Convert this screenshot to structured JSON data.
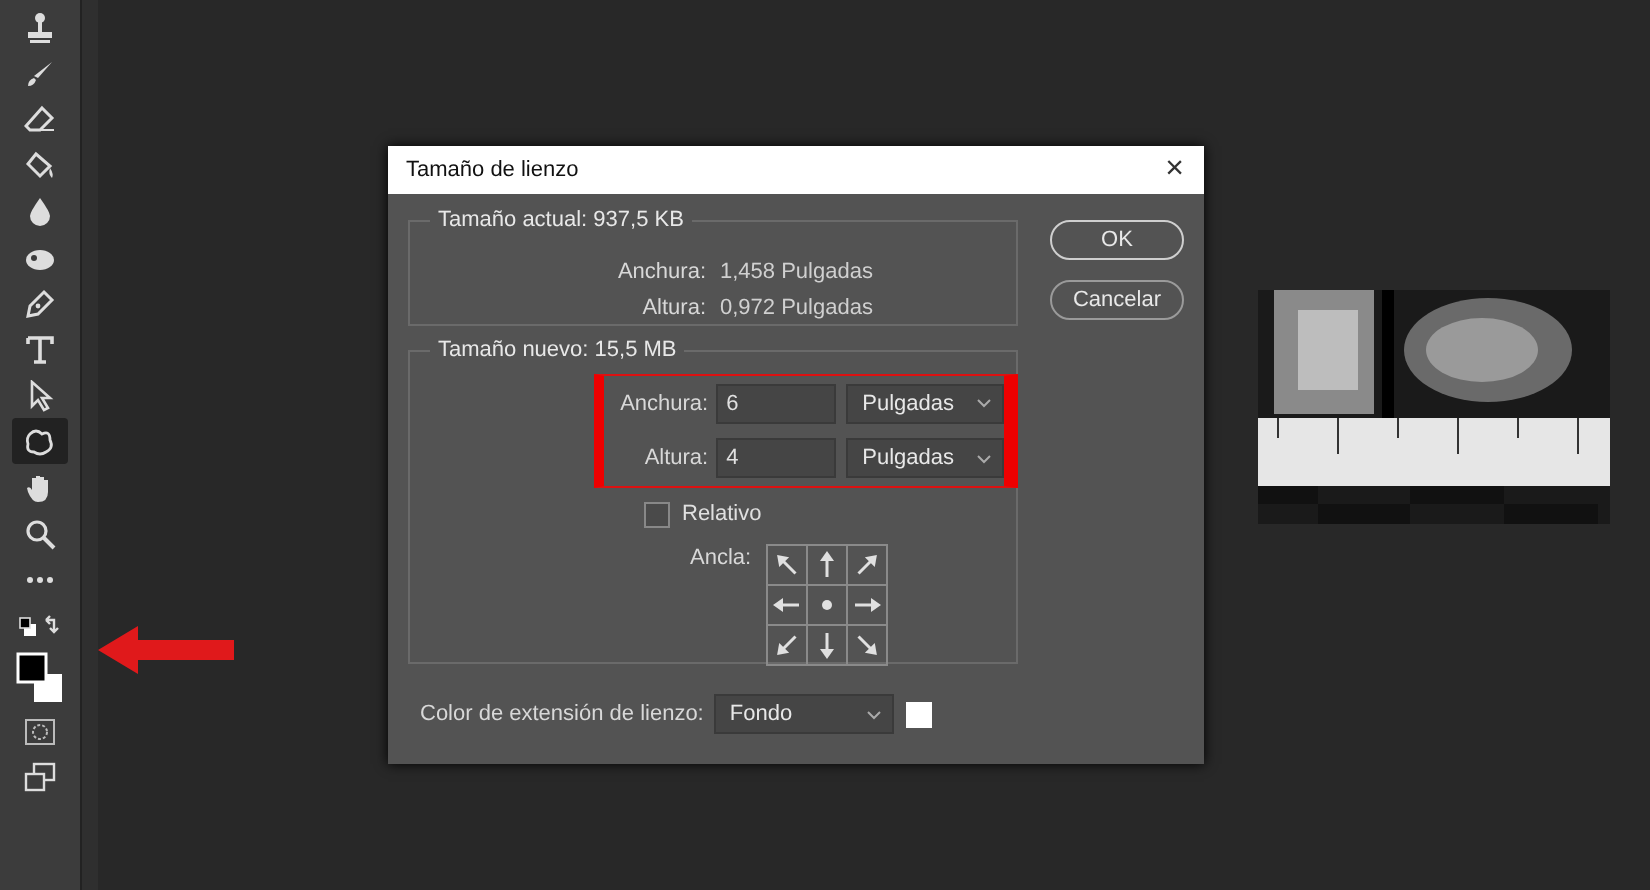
{
  "toolbar": {
    "tools": [
      {
        "kind": "stamp",
        "selected": false
      },
      {
        "kind": "brush",
        "selected": false
      },
      {
        "kind": "eraser",
        "selected": false
      },
      {
        "kind": "bucket",
        "selected": false
      },
      {
        "kind": "drop",
        "selected": false
      },
      {
        "kind": "smudge",
        "selected": false
      },
      {
        "kind": "pen",
        "selected": false
      },
      {
        "kind": "type",
        "selected": false
      },
      {
        "kind": "pointer",
        "selected": false
      },
      {
        "kind": "shape",
        "selected": true
      },
      {
        "kind": "hand",
        "selected": false
      },
      {
        "kind": "zoom",
        "selected": false
      },
      {
        "kind": "more",
        "selected": false
      },
      {
        "kind": "swatches",
        "selected": false
      },
      {
        "kind": "colors",
        "selected": false
      },
      {
        "kind": "mask",
        "selected": false
      },
      {
        "kind": "screen",
        "selected": false
      }
    ]
  },
  "dialog": {
    "title": "Tamaño de lienzo",
    "close": "×",
    "current_size": {
      "legend": "Tamaño actual: 937,5 KB",
      "rows": [
        {
          "label": "Anchura:",
          "value": "1,458 Pulgadas"
        },
        {
          "label": "Altura:",
          "value": "0,972 Pulgadas"
        }
      ]
    },
    "new_size": {
      "legend": "Tamaño nuevo: 15,5 MB",
      "fields": [
        {
          "label": "Anchura:",
          "value": "6",
          "unit": "Pulgadas"
        },
        {
          "label": "Altura:",
          "value": "4",
          "unit": "Pulgadas"
        }
      ],
      "relative": {
        "label": "Relativo",
        "checked": false
      },
      "anchor": {
        "label": "Ancla:"
      }
    },
    "extension": {
      "label": "Color de extensión de lienzo:",
      "value": "Fondo"
    },
    "buttons": [
      {
        "label": "OK"
      },
      {
        "label": "Cancelar"
      }
    ]
  }
}
